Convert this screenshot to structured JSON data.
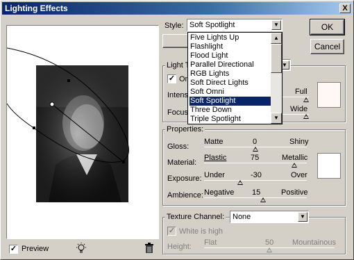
{
  "window": {
    "title": "Lighting Effects",
    "close_label": "X"
  },
  "buttons": {
    "ok": "OK",
    "cancel": "Cancel"
  },
  "style": {
    "label": "Style:",
    "value": "Soft Spotlight",
    "options": [
      "Five Lights Up",
      "Flashlight",
      "Flood Light",
      "Parallel Directional",
      "RGB Lights",
      "Soft Direct Lights",
      "Soft Omni",
      "Soft Spotlight",
      "Three Down",
      "Triple Spotlight"
    ],
    "selected_index": 7
  },
  "light_type": {
    "group_label": "Light Ty",
    "on_label": "On",
    "intensity_label": "Intens",
    "intensity_right": "Full",
    "focus_label": "Focus",
    "focus_right": "Wide",
    "color": "#fff8f5"
  },
  "properties": {
    "group_label": "Properties:",
    "color": "#ffffff",
    "rows": [
      {
        "label": "Gloss:",
        "left": "Matte",
        "value": "0",
        "right": "Shiny",
        "level": 0.5
      },
      {
        "label": "Material:",
        "left": "Plastic",
        "value": "75",
        "right": "Metallic",
        "level": 0.875
      },
      {
        "label": "Exposure:",
        "left": "Under",
        "value": "-30",
        "right": "Over",
        "level": 0.35
      },
      {
        "label": "Ambience:",
        "left": "Negative",
        "value": "15",
        "right": "Positive",
        "level": 0.575
      }
    ]
  },
  "texture": {
    "label": "Texture Channel:",
    "value": "None",
    "white_is_high": "White is high",
    "height_label": "Height:",
    "height_left": "Flat",
    "height_value": "50",
    "height_right": "Mountainous"
  },
  "preview": {
    "label": "Preview"
  }
}
